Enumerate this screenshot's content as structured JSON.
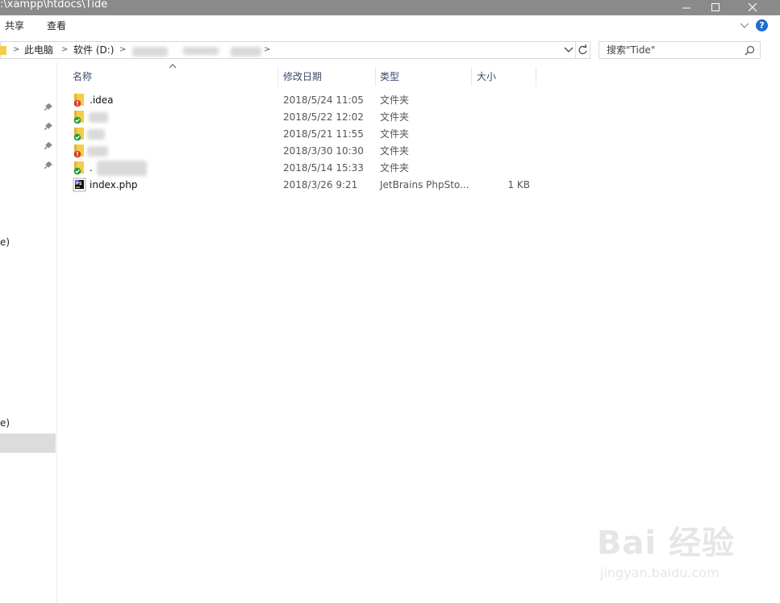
{
  "window": {
    "title": ":\\xampp\\htdocs\\Tide"
  },
  "ribbon": {
    "tabs": [
      "共享",
      "查看"
    ],
    "help_label": "?"
  },
  "address": {
    "segments": [
      "此电脑",
      "软件 (D:)"
    ]
  },
  "search": {
    "placeholder": "搜索\"Tide\""
  },
  "nav": {
    "labels": [
      "e)",
      "e)"
    ]
  },
  "columns": {
    "name": "名称",
    "date": "修改日期",
    "type": "类型",
    "size": "大小"
  },
  "rows": [
    {
      "name": ".idea",
      "date": "2018/5/24 11:05",
      "type": "文件夹",
      "size": "",
      "icon": "folder-conflict-icon"
    },
    {
      "name": "",
      "date": "2018/5/22 12:02",
      "type": "文件夹",
      "size": "",
      "icon": "folder-synced-icon"
    },
    {
      "name": "",
      "date": "2018/5/21 11:55",
      "type": "文件夹",
      "size": "",
      "icon": "folder-synced-icon"
    },
    {
      "name": "",
      "date": "2018/3/30 10:30",
      "type": "文件夹",
      "size": "",
      "icon": "folder-conflict-icon"
    },
    {
      "name": ".",
      "date": "2018/5/14 15:33",
      "type": "文件夹",
      "size": "",
      "icon": "folder-synced-icon"
    },
    {
      "name": "index.php",
      "date": "2018/3/26 9:21",
      "type": "JetBrains PhpSto...",
      "size": "1 KB",
      "icon": "phpstorm-file-icon"
    }
  ],
  "watermark": {
    "brand": "Bai 经验",
    "url": "jingyan.baidu.com"
  },
  "colors": {
    "titlebar": "#8a8a8a",
    "conflict_badge": "#d83b2b",
    "synced_badge": "#1f9d3a",
    "folder": "#f5cd48",
    "header_text": "#3a4a6b"
  }
}
